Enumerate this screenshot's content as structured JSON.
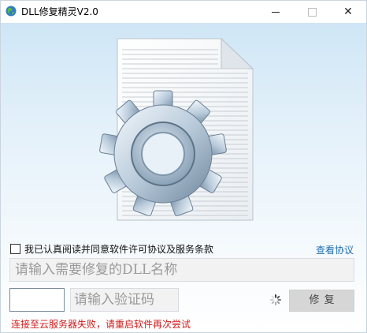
{
  "window": {
    "title": "DLL修复精灵V2.0",
    "minimize_label": "—",
    "close_label": "✕"
  },
  "agreement": {
    "checked": false,
    "label": "我已认真阅读并同意软件许可协议及服务条款",
    "view_link": "查看协议"
  },
  "dll_input": {
    "placeholder": "请输入需要修复的DLL名称",
    "value": ""
  },
  "captcha": {
    "code_value": "",
    "placeholder": "请输入验证码"
  },
  "repair_button": {
    "label": "修复"
  },
  "status": {
    "message": "连接至云服务器失败，请重启软件再次尝试",
    "color": "#d01c1c"
  },
  "colors": {
    "link": "#1f6fb2",
    "accent_bg": "#cfe6f6"
  }
}
